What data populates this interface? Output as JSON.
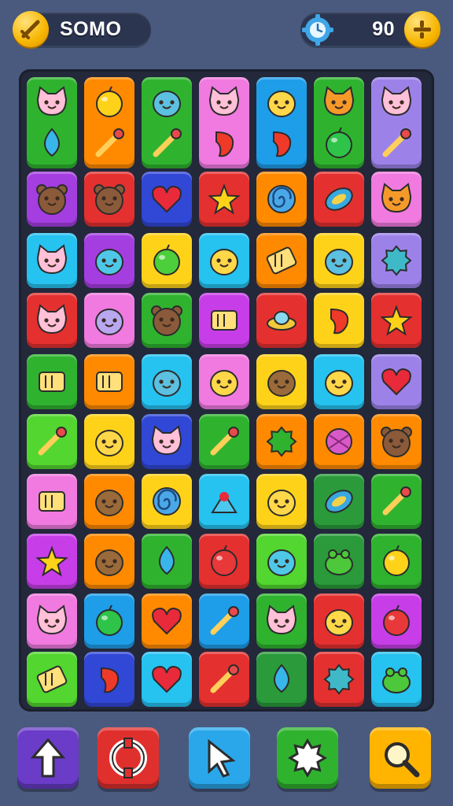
{
  "hud": {
    "score_label": "SOMO",
    "score_icon": "sword-coin-icon",
    "timer_value": "90",
    "timer_icon": "stopwatch-gear-icon",
    "add_icon": "plus-coin-icon"
  },
  "colors": {
    "green": "#2fb32f",
    "orange": "#ff8a00",
    "pink": "#f07adf",
    "blue": "#1e9de8",
    "lavender": "#9c82e8",
    "purple": "#a43ee0",
    "red": "#e53030",
    "navy": "#3147d6",
    "yellow": "#ffd21a",
    "cyan": "#26c2f0",
    "lime": "#53d62f",
    "magenta": "#c73ee8",
    "darkgreen": "#2a9a3a",
    "teal": "#33b3a0"
  },
  "board": {
    "rows": [
      [
        {
          "color": "green",
          "icon": "cat-face-icon",
          "icon2": "water-drop-icon",
          "tall": true
        },
        {
          "color": "orange",
          "icon": "tomato-icon",
          "icon2": "paintbrush-icon",
          "tall": true
        },
        {
          "color": "green",
          "icon": "bird-face-icon",
          "icon2": "paintbrush-icon",
          "tall": true
        },
        {
          "color": "pink",
          "icon": "cat-face-icon",
          "icon2": "chili-icon",
          "tall": true
        },
        {
          "color": "blue",
          "icon": "chick-icon",
          "icon2": "rocket-icon",
          "tall": true
        },
        {
          "color": "green",
          "icon": "fox-face-icon",
          "icon2": "ball-icon",
          "tall": true
        },
        {
          "color": "lavender",
          "icon": "cat-face-icon",
          "icon2": "paintbrush-icon",
          "tall": true
        }
      ],
      [
        {
          "color": "purple",
          "icon": "bear-face-icon"
        },
        {
          "color": "red",
          "icon": "bear-face-icon"
        },
        {
          "color": "navy",
          "icon": "heart-icon"
        },
        {
          "color": "red",
          "icon": "star-icon"
        },
        {
          "color": "orange",
          "icon": "swirl-icon"
        },
        {
          "color": "red",
          "icon": "candy-icon"
        },
        {
          "color": "pink",
          "icon": "fox-face-icon"
        }
      ],
      [
        {
          "color": "cyan",
          "icon": "cat-face-icon"
        },
        {
          "color": "purple",
          "icon": "blob-face-icon"
        },
        {
          "color": "yellow",
          "icon": "apple-icon"
        },
        {
          "color": "cyan",
          "icon": "chick-icon"
        },
        {
          "color": "orange",
          "icon": "battery-icon"
        },
        {
          "color": "yellow",
          "icon": "bird-face-icon"
        },
        {
          "color": "lavender",
          "icon": "spiky-blob-icon"
        }
      ],
      [
        {
          "color": "red",
          "icon": "cat-face-icon"
        },
        {
          "color": "pink",
          "icon": "ghost-face-icon"
        },
        {
          "color": "green",
          "icon": "bear-face-icon"
        },
        {
          "color": "magenta",
          "icon": "crayons-icon"
        },
        {
          "color": "red",
          "icon": "ufo-icon"
        },
        {
          "color": "yellow",
          "icon": "flame-icon"
        },
        {
          "color": "red",
          "icon": "star-icon"
        }
      ],
      [
        {
          "color": "green",
          "icon": "cube-icon"
        },
        {
          "color": "orange",
          "icon": "bench-icon"
        },
        {
          "color": "cyan",
          "icon": "bird-face-icon"
        },
        {
          "color": "pink",
          "icon": "chick-icon"
        },
        {
          "color": "yellow",
          "icon": "cookie-face-icon"
        },
        {
          "color": "cyan",
          "icon": "chick-icon"
        },
        {
          "color": "lavender",
          "icon": "heart-icon"
        }
      ],
      [
        {
          "color": "lime",
          "icon": "pencil-icon"
        },
        {
          "color": "yellow",
          "icon": "chick-icon"
        },
        {
          "color": "navy",
          "icon": "cat-face-icon"
        },
        {
          "color": "green",
          "icon": "paintbrush-icon"
        },
        {
          "color": "orange",
          "icon": "splat-icon"
        },
        {
          "color": "orange",
          "icon": "yarn-ball-icon"
        },
        {
          "color": "orange",
          "icon": "bear-face-icon"
        }
      ],
      [
        {
          "color": "pink",
          "icon": "frame-icon"
        },
        {
          "color": "orange",
          "icon": "cookie-face-icon"
        },
        {
          "color": "yellow",
          "icon": "swirl-icon"
        },
        {
          "color": "cyan",
          "icon": "heart-bag-icon"
        },
        {
          "color": "yellow",
          "icon": "chick-icon"
        },
        {
          "color": "darkgreen",
          "icon": "candy-icon"
        },
        {
          "color": "green",
          "icon": "paintbrush-icon"
        }
      ],
      [
        {
          "color": "magenta",
          "icon": "star-icon"
        },
        {
          "color": "orange",
          "icon": "cookie-face-icon"
        },
        {
          "color": "green",
          "icon": "leaf-icon"
        },
        {
          "color": "red",
          "icon": "balloon-icon"
        },
        {
          "color": "lime",
          "icon": "blob-face-icon"
        },
        {
          "color": "darkgreen",
          "icon": "frog-icon"
        },
        {
          "color": "green",
          "icon": "sun-blob-icon"
        }
      ],
      [
        {
          "color": "pink",
          "icon": "cat-face-icon"
        },
        {
          "color": "blue",
          "icon": "ball-icon"
        },
        {
          "color": "orange",
          "icon": "heart-icon"
        },
        {
          "color": "blue",
          "icon": "lollipop-icon"
        },
        {
          "color": "green",
          "icon": "cat-face-icon"
        },
        {
          "color": "red",
          "icon": "chick-icon"
        },
        {
          "color": "magenta",
          "icon": "balloon-icon"
        }
      ],
      [
        {
          "color": "lime",
          "icon": "battery-icon"
        },
        {
          "color": "navy",
          "icon": "chili-icon"
        },
        {
          "color": "cyan",
          "icon": "heart-icon"
        },
        {
          "color": "red",
          "icon": "paintbrush-icon"
        },
        {
          "color": "darkgreen",
          "icon": "fish-icon"
        },
        {
          "color": "red",
          "icon": "spiky-blob-icon"
        },
        {
          "color": "cyan",
          "icon": "frog-icon"
        }
      ]
    ]
  },
  "toolbar": [
    {
      "name": "up-arrow-button",
      "icon": "up-arrow-icon",
      "color": "#6a3cc8"
    },
    {
      "name": "lifebuoy-button",
      "icon": "lifebuoy-icon",
      "color": "#e0302e"
    },
    {
      "name": "cursor-button",
      "icon": "cursor-icon",
      "color": "#2aa7ea"
    },
    {
      "name": "shuffle-button",
      "icon": "burst-icon",
      "color": "#2fb32f"
    },
    {
      "name": "search-button",
      "icon": "search-icon",
      "color": "#ffb400"
    }
  ]
}
